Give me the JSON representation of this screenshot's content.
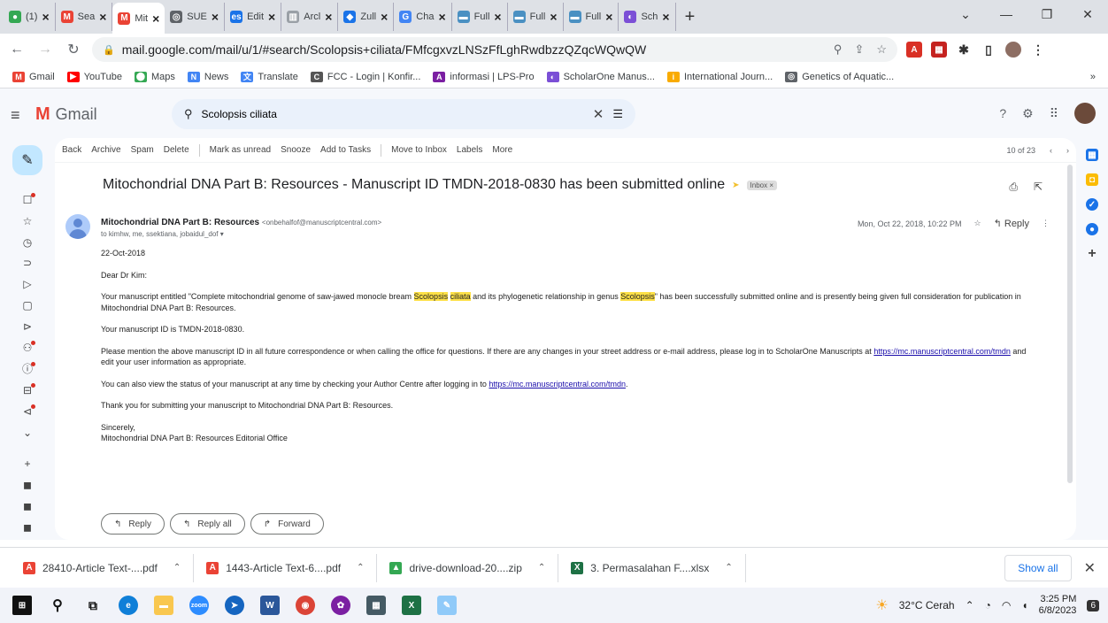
{
  "tabs": [
    {
      "label": "(1)",
      "color": "#34a853",
      "glyph": "●"
    },
    {
      "label": "Sea",
      "color": "#ea4335",
      "glyph": "M"
    },
    {
      "label": "Mit",
      "color": "#ea4335",
      "glyph": "M",
      "active": true
    },
    {
      "label": "SUE",
      "color": "#5f6368",
      "glyph": "◎"
    },
    {
      "label": "Edit",
      "color": "#1a73e8",
      "glyph": "es"
    },
    {
      "label": "Arcl",
      "color": "#9aa0a6",
      "glyph": "▥"
    },
    {
      "label": "Zull",
      "color": "#1a73e8",
      "glyph": "◆"
    },
    {
      "label": "Cha",
      "color": "#4285f4",
      "glyph": "G"
    },
    {
      "label": "Full",
      "color": "#4a90c2",
      "glyph": "▬"
    },
    {
      "label": "Full",
      "color": "#4a90c2",
      "glyph": "▬"
    },
    {
      "label": "Full",
      "color": "#4a90c2",
      "glyph": "▬"
    },
    {
      "label": "Sch",
      "color": "#7b4fd6",
      "glyph": "◐"
    }
  ],
  "address_bar": {
    "url": "mail.google.com/mail/u/1/#search/Scolopsis+ciliata/FMfcgxvzLNSzFfLghRwdbzzQZqcWQwQW"
  },
  "bookmarks": [
    {
      "label": "Gmail",
      "color": "#ea4335",
      "glyph": "M"
    },
    {
      "label": "YouTube",
      "color": "#ff0000",
      "glyph": "▶"
    },
    {
      "label": "Maps",
      "color": "#34a853",
      "glyph": "⬤"
    },
    {
      "label": "News",
      "color": "#4285f4",
      "glyph": "N"
    },
    {
      "label": "Translate",
      "color": "#4285f4",
      "glyph": "文"
    },
    {
      "label": "FCC - Login | Konfir...",
      "color": "#555555",
      "glyph": "C"
    },
    {
      "label": "informasi | LPS-Pro",
      "color": "#7b1fa2",
      "glyph": "A"
    },
    {
      "label": "ScholarOne Manus...",
      "color": "#7b4fd6",
      "glyph": "◐"
    },
    {
      "label": "International Journ...",
      "color": "#f9ab00",
      "glyph": "i"
    },
    {
      "label": "Genetics of Aquatic...",
      "color": "#5f6368",
      "glyph": "◎"
    }
  ],
  "gmail": {
    "brand": "Gmail",
    "search_value": "Scolopsis ciliata",
    "actions": [
      "Back",
      "Archive",
      "Spam",
      "Delete",
      "Mark as unread",
      "Snooze",
      "Add to Tasks",
      "Move to Inbox",
      "Labels",
      "More"
    ],
    "pager": "10 of 23",
    "subject": "Mitochondrial DNA Part B: Resources - Manuscript ID TMDN-2018-0830 has been submitted online",
    "label_badge": "Inbox ×",
    "sender_name": "Mitochondrial DNA Part B: Resources",
    "sender_addr": "<onbehalfof@manuscriptcentral.com>",
    "to_line": "to kimhw, me, ssektiana, jobaidul_dof ▾",
    "date": "Mon, Oct 22, 2018, 10:22 PM",
    "reply_label": "Reply",
    "body": {
      "date_line": "22-Oct-2018",
      "greeting": "Dear Dr Kim:",
      "p1_a": "Your manuscript entitled \"Complete mitochondrial genome of saw-jawed monocle bream ",
      "p1_hl1": "Scolopsis",
      "p1_hl2": "ciliata",
      "p1_b": " and its phylogenetic relationship in genus ",
      "p1_hl3": "Scolopsis",
      "p1_c": "\" has been successfully submitted online and is presently being given full consideration for publication in Mitochondrial DNA Part B: Resources.",
      "p2": "Your manuscript ID is TMDN-2018-0830.",
      "p3_a": "Please mention the above manuscript ID in all future correspondence or when calling the office for questions. If there are any changes in your street address or e-mail address, please log in to ScholarOne Manuscripts at ",
      "p3_link": "https://mc.manuscriptcentral.com/tmdn",
      "p3_b": " and edit your user information as appropriate.",
      "p4_a": "You can also view the status of your manuscript at any time by checking your Author Centre after logging in to ",
      "p4_link": "https://mc.manuscriptcentral.com/tmdn",
      "p4_b": ".",
      "p5": "Thank you for submitting your manuscript to Mitochondrial DNA Part B: Resources.",
      "sign1": "Sincerely,",
      "sign2": "Mitochondrial DNA Part B: Resources Editorial Office"
    },
    "reply_buttons": [
      "Reply",
      "Reply all",
      "Forward"
    ]
  },
  "downloads": [
    {
      "name": "28410-Article Text-....pdf",
      "color": "#ea4335",
      "glyph": "A"
    },
    {
      "name": "1443-Article Text-6....pdf",
      "color": "#ea4335",
      "glyph": "A"
    },
    {
      "name": "drive-download-20....zip",
      "color": "#34a853",
      "glyph": "▲"
    },
    {
      "name": "3. Permasalahan F....xlsx",
      "color": "#1e7145",
      "glyph": "X"
    }
  ],
  "show_all": "Show all",
  "taskbar": {
    "weather": "32°C Cerah",
    "time": "3:25 PM",
    "date": "6/8/2023",
    "notif": "6"
  }
}
